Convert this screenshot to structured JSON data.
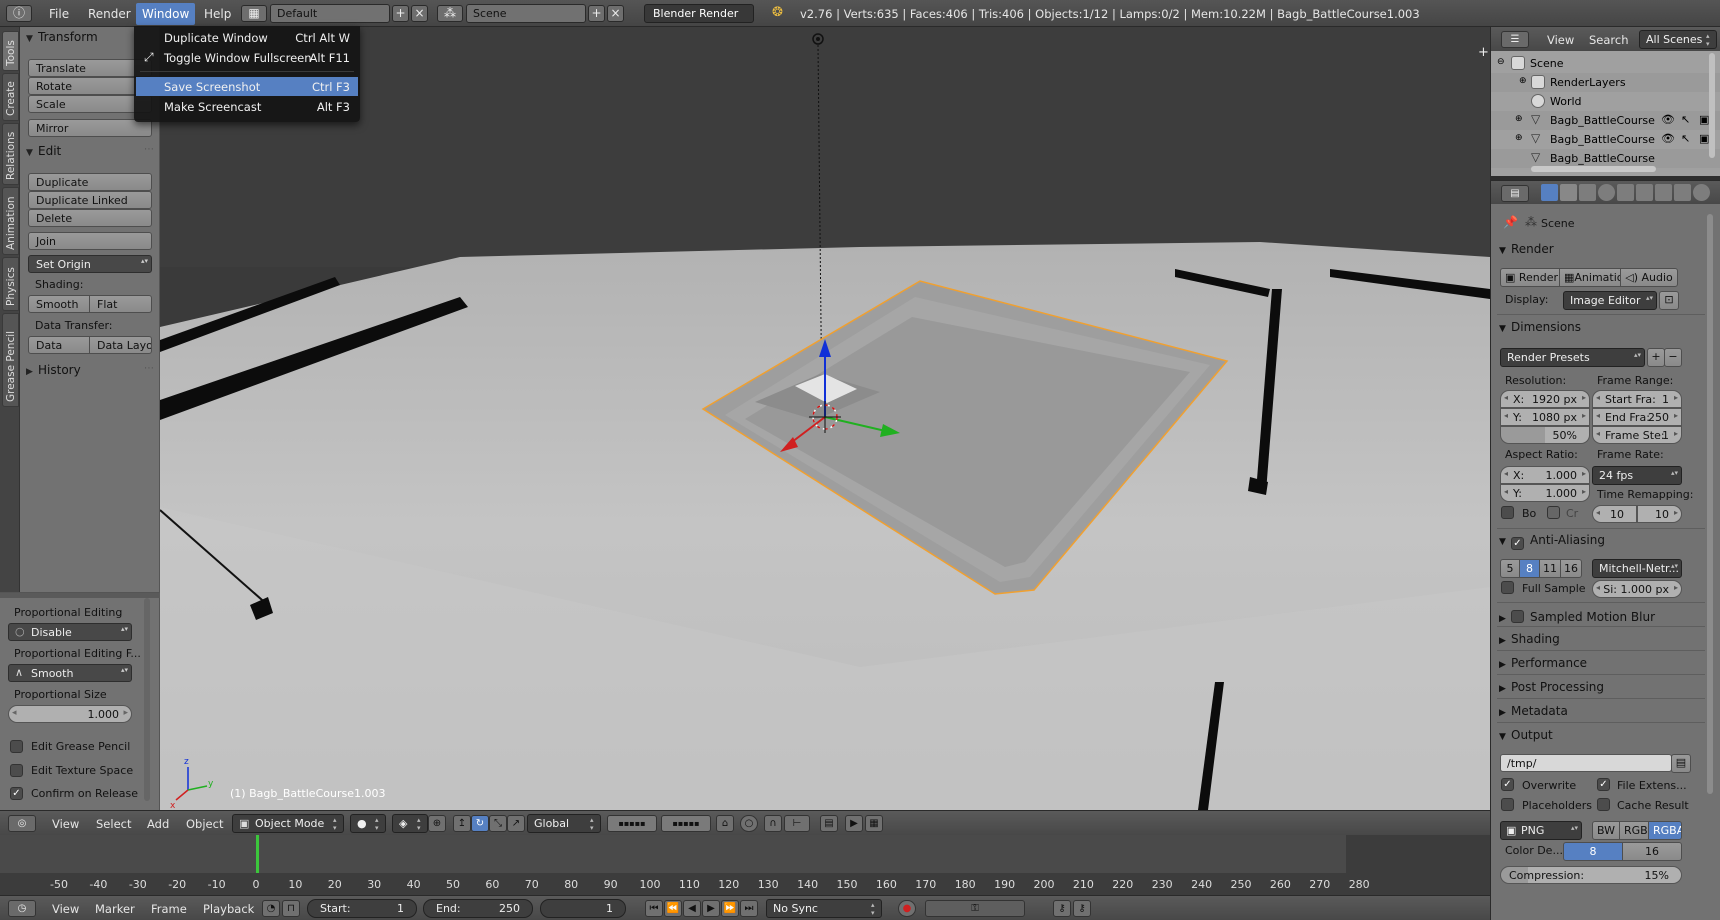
{
  "topbar": {
    "menus": [
      "File",
      "Render",
      "Window",
      "Help"
    ],
    "layout": "Default",
    "scene": "Scene",
    "engine": "Blender Render",
    "stats": "v2.76 | Verts:635 | Faces:406 | Tris:406 | Objects:1/12 | Lamps:0/2 | Mem:10.22M | Bagb_BattleCourse1.003"
  },
  "window_menu": {
    "items": [
      {
        "label": "Duplicate Window",
        "shortcut": "Ctrl Alt W"
      },
      {
        "label": "Toggle Window Fullscreen",
        "shortcut": "Alt F11"
      },
      {
        "label": "Save Screenshot",
        "shortcut": "Ctrl F3"
      },
      {
        "label": "Make Screencast",
        "shortcut": "Alt F3"
      }
    ]
  },
  "left_tabs": [
    "Tools",
    "Create",
    "Relations",
    "Animation",
    "Physics",
    "Grease Pencil"
  ],
  "toolshelf": {
    "transform": {
      "title": "Transform",
      "buttons": [
        "Translate",
        "Rotate",
        "Scale",
        "Mirror"
      ]
    },
    "edit": {
      "title": "Edit",
      "buttons": [
        "Duplicate",
        "Duplicate Linked",
        "Delete",
        "Join"
      ],
      "set_origin": "Set Origin"
    },
    "shading": {
      "label": "Shading:",
      "smooth": "Smooth",
      "flat": "Flat"
    },
    "data_transfer": {
      "label": "Data Transfer:",
      "data": "Data",
      "data_layout": "Data Layo"
    },
    "history": "History"
  },
  "operator": {
    "prop_editing_label": "Proportional Editing",
    "prop_editing_value": "Disable",
    "prop_falloff_label": "Proportional Editing F...",
    "prop_falloff_value": "Smooth",
    "prop_size_label": "Proportional Size",
    "prop_size_value": "1.000",
    "checks": [
      {
        "label": "Edit Grease Pencil",
        "checked": false
      },
      {
        "label": "Edit Texture Space",
        "checked": false
      },
      {
        "label": "Confirm on Release",
        "checked": true
      }
    ]
  },
  "viewport": {
    "object_label": "(1) Bagb_BattleCourse1.003"
  },
  "view3d_header": {
    "menus": [
      "View",
      "Select",
      "Add",
      "Object"
    ],
    "mode": "Object Mode",
    "orientation": "Global"
  },
  "timeline": {
    "ticks": [
      -50,
      -40,
      -30,
      -20,
      -10,
      0,
      10,
      20,
      30,
      40,
      50,
      60,
      70,
      80,
      90,
      100,
      110,
      120,
      130,
      140,
      150,
      160,
      170,
      180,
      190,
      200,
      210,
      220,
      230,
      240,
      250,
      260,
      270,
      280
    ],
    "current_frame": 1
  },
  "timeline_header": {
    "menus": [
      "View",
      "Marker",
      "Frame",
      "Playback"
    ],
    "start_label": "Start:",
    "start_value": "1",
    "end_label": "End:",
    "end_value": "250",
    "current": "1",
    "sync": "No Sync"
  },
  "outliner": {
    "menus": [
      "View",
      "Search"
    ],
    "filter": "All Scenes",
    "rows": [
      "Scene",
      "RenderLayers",
      "World",
      "Bagb_BattleCourse",
      "Bagb_BattleCourse",
      "Bagb_BattleCourse"
    ]
  },
  "properties": {
    "context": "Scene",
    "render": {
      "title": "Render",
      "buttons": [
        "Render",
        "Animatio",
        "Audio"
      ],
      "display_label": "Display:",
      "display_value": "Image Editor"
    },
    "dimensions": {
      "title": "Dimensions",
      "presets": "Render Presets",
      "resolution_label": "Resolution:",
      "res_x": {
        "label": "X:",
        "value": "1920 px"
      },
      "res_y": {
        "label": "Y:",
        "value": "1080 px"
      },
      "res_pct": "50%",
      "frame_range_label": "Frame Range:",
      "start": {
        "label": "Start Fra:",
        "value": "1"
      },
      "end": {
        "label": "End Fra:",
        "value": "250"
      },
      "step": {
        "label": "Frame Ste:",
        "value": "1"
      },
      "aspect_label": "Aspect Ratio:",
      "aspect_x": {
        "label": "X:",
        "value": "1.000"
      },
      "aspect_y": {
        "label": "Y:",
        "value": "1.000"
      },
      "border": "Bo",
      "crop": "Cr",
      "frame_rate_label": "Frame Rate:",
      "frame_rate": "24 fps",
      "time_remap_label": "Time Remapping:",
      "remap_old": "10",
      "remap_new": "10"
    },
    "anti_aliasing": {
      "title": "Anti-Aliasing",
      "samples": [
        "5",
        "8",
        "11",
        "16"
      ],
      "selected": "8",
      "filter": "Mitchell-Netr...",
      "full_sample": "Full Sample",
      "size": "Si: 1.000 px"
    },
    "collapsed": [
      "Sampled Motion Blur",
      "Shading",
      "Performance",
      "Post Processing",
      "Metadata"
    ],
    "output": {
      "title": "Output",
      "path": "/tmp/",
      "overwrite": "Overwrite",
      "file_ext": "File Extens...",
      "placeholders": "Placeholders",
      "cache": "Cache Result",
      "format": "PNG",
      "modes": [
        "BW",
        "RGB",
        "RGBA"
      ],
      "color_depth_label": "Color De...",
      "depths": [
        "8",
        "16"
      ],
      "compression_label": "Compression:",
      "compression_value": "15%"
    }
  },
  "colors": {
    "accent": "#5680c2",
    "selected_outline": "#f0a030"
  }
}
